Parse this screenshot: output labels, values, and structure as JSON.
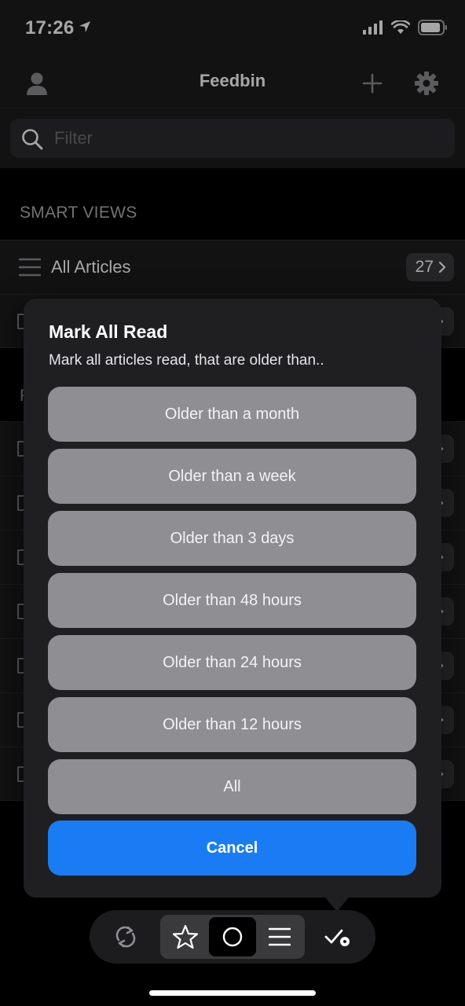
{
  "status": {
    "time": "17:26"
  },
  "header": {
    "title": "Feedbin"
  },
  "search": {
    "placeholder": "Filter"
  },
  "smart_views": {
    "section_label": "SMART VIEWS",
    "items": [
      {
        "label": "All Articles",
        "count": "27"
      }
    ]
  },
  "dialog": {
    "title": "Mark All Read",
    "subtitle": "Mark all articles read, that are older than..",
    "options": [
      "Older than a month",
      "Older than a week",
      "Older than 3 days",
      "Older than 48 hours",
      "Older than 24 hours",
      "Older than 12 hours",
      "All"
    ],
    "cancel_label": "Cancel"
  },
  "colors": {
    "accent": "#1a7cf5",
    "option_bg": "#8e8e93",
    "popover_bg": "#1f1f21"
  },
  "toolbar": {
    "icons": [
      "refresh-icon",
      "star-icon",
      "unread-circle-icon",
      "list-icon",
      "mark-read-icon"
    ],
    "selected_filter": "unread"
  }
}
